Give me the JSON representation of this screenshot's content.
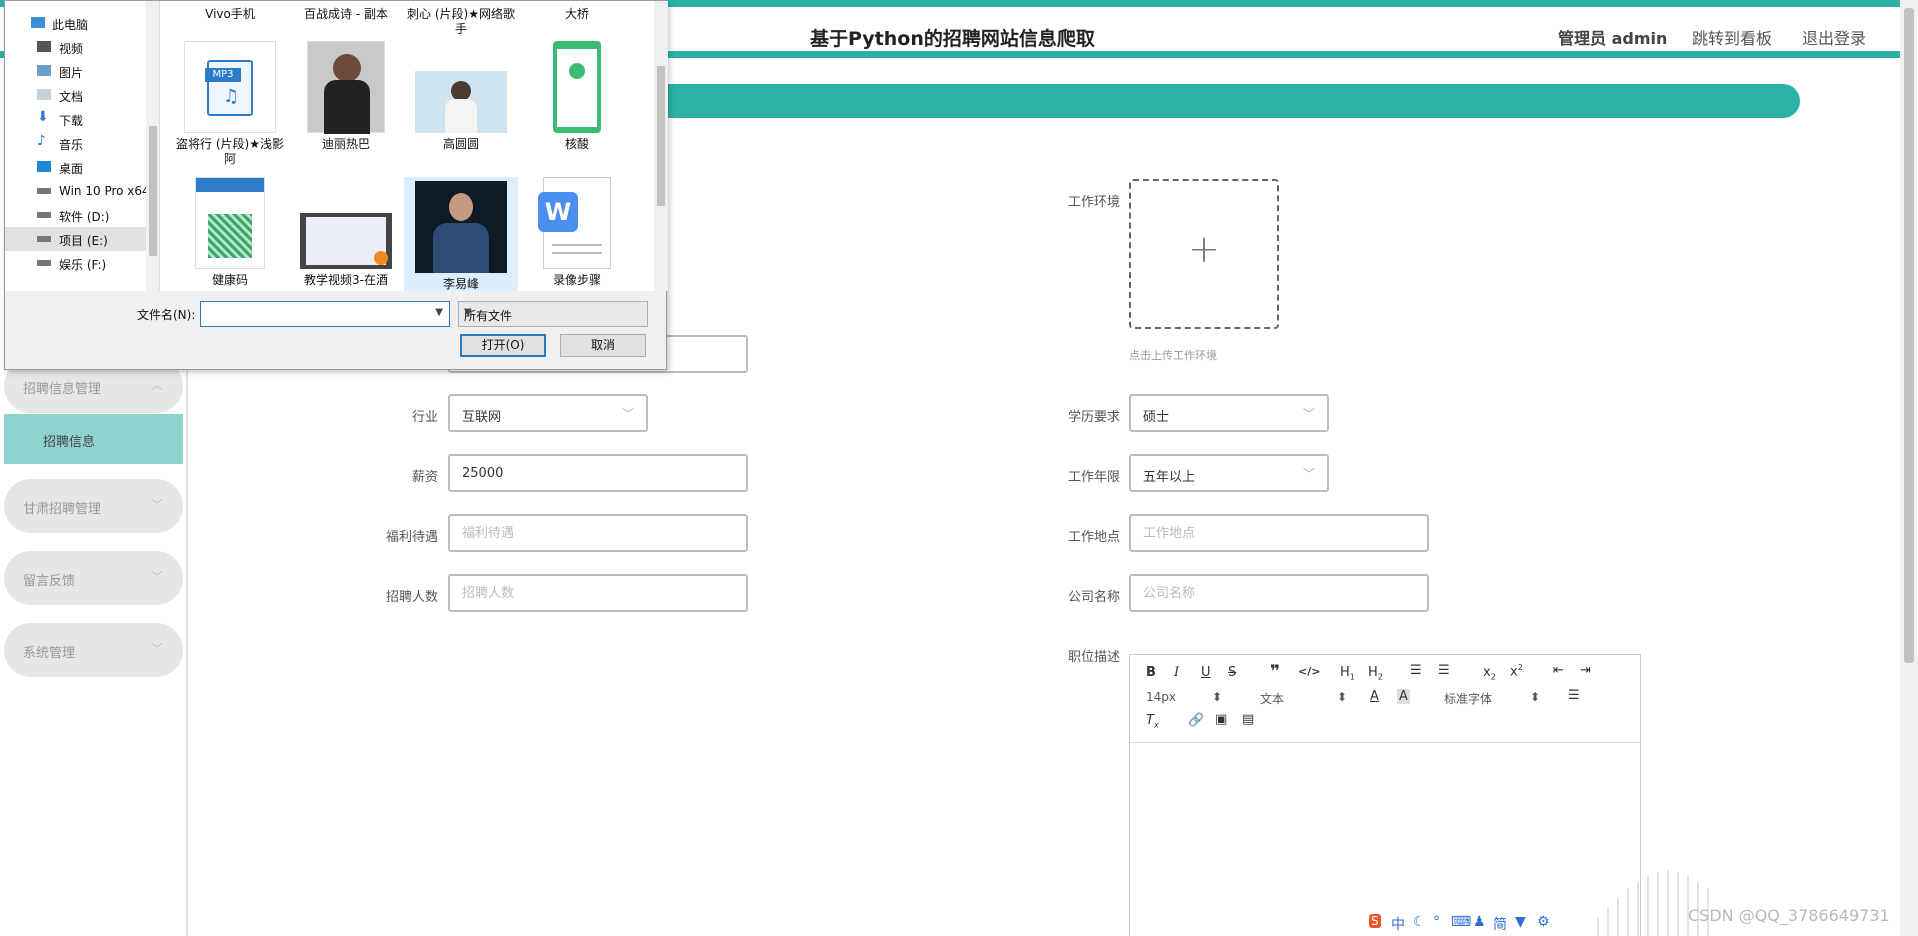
{
  "header": {
    "title": "基于Python的招聘网站信息爬取",
    "user": "管理员 admin",
    "dashboard_link": "跳转到看板",
    "logout_link": "退出登录"
  },
  "sidebar": {
    "groups": [
      {
        "label": "招聘信息管理",
        "chevron": "up"
      },
      {
        "label": "甘肃招聘管理",
        "chevron": "down"
      },
      {
        "label": "留言反馈",
        "chevron": "down"
      },
      {
        "label": "系统管理",
        "chevron": "down"
      }
    ],
    "active_item": "招聘信息"
  },
  "form": {
    "industry": {
      "label": "行业",
      "value": "互联网"
    },
    "salary": {
      "label": "薪资",
      "value": "25000"
    },
    "benefits": {
      "label": "福利待遇",
      "placeholder": "福利待遇"
    },
    "headcount": {
      "label": "招聘人数",
      "placeholder": "招聘人数"
    },
    "work_env": {
      "label": "工作环境",
      "hint": "点击上传工作环境"
    },
    "education": {
      "label": "学历要求",
      "value": "硕士"
    },
    "experience": {
      "label": "工作年限",
      "value": "五年以上"
    },
    "location": {
      "label": "工作地点",
      "placeholder": "工作地点"
    },
    "company": {
      "label": "公司名称",
      "placeholder": "公司名称"
    },
    "description": {
      "label": "职位描述"
    }
  },
  "editor": {
    "font_size": "14px",
    "paragraph": "文本",
    "font_family": "标准字体"
  },
  "file_dialog": {
    "tree": [
      {
        "label": "此电脑",
        "icon": "computer-icon"
      },
      {
        "label": "视频",
        "icon": "video-folder-icon"
      },
      {
        "label": "图片",
        "icon": "picture-folder-icon"
      },
      {
        "label": "文档",
        "icon": "document-folder-icon"
      },
      {
        "label": "下载",
        "icon": "download-icon"
      },
      {
        "label": "音乐",
        "icon": "music-icon"
      },
      {
        "label": "桌面",
        "icon": "desktop-icon"
      },
      {
        "label": "Win 10 Pro x64",
        "icon": "drive-icon"
      },
      {
        "label": "软件 (D:)",
        "icon": "drive-icon"
      },
      {
        "label": "项目 (E:)",
        "icon": "drive-icon"
      },
      {
        "label": "娱乐 (F:)",
        "icon": "drive-icon"
      }
    ],
    "top_row": [
      "Vivo手机",
      "百战成诗 - 副本",
      "刺心 (片段)★网络歌手",
      "大桥"
    ],
    "files": [
      {
        "name": "盗将行 (片段)★浅影阿",
        "type": "mp3"
      },
      {
        "name": "迪丽热巴",
        "type": "photo"
      },
      {
        "name": "高圆圆",
        "type": "photo"
      },
      {
        "name": "核酸",
        "type": "phone"
      },
      {
        "name": "健康码",
        "type": "phone"
      },
      {
        "name": "教学视频3-在酒",
        "type": "video"
      },
      {
        "name": "李易峰",
        "type": "photo"
      },
      {
        "name": "录像步骤",
        "type": "wps"
      }
    ],
    "filename_label": "文件名(N):",
    "filter": "所有文件",
    "open_button": "打开(O)",
    "cancel_button": "取消"
  },
  "watermark": "CSDN @QQ_3786649731",
  "ime": "中"
}
